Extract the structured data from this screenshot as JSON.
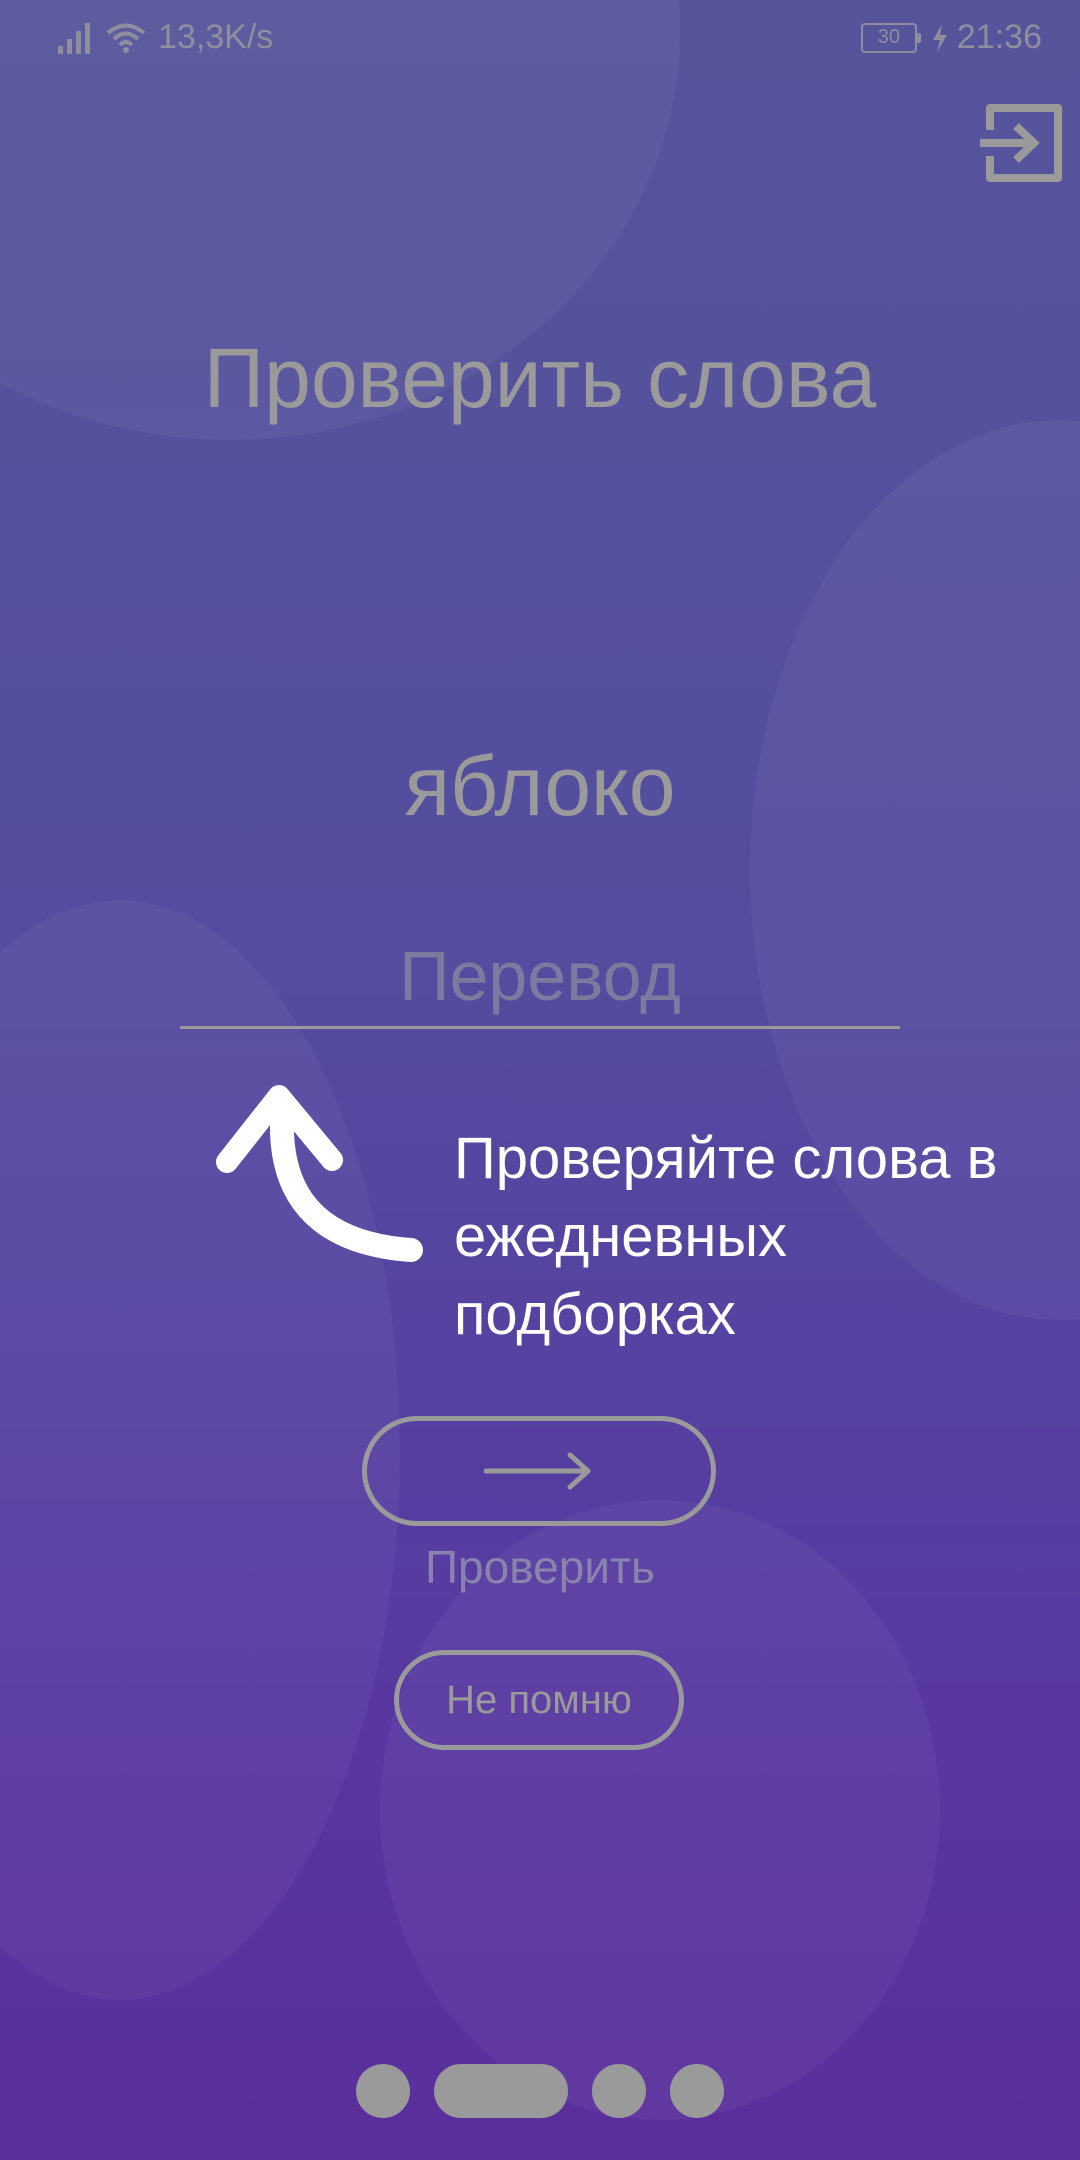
{
  "status_bar": {
    "network_speed": "13,3K/s",
    "battery_level": "30",
    "time": "21:36"
  },
  "header": {
    "logout_icon": "exit-arrow-icon"
  },
  "main": {
    "title": "Проверить слова",
    "word": "яблоко",
    "translation_placeholder": "Перевод",
    "translation_value": "",
    "hint_text": "Проверяйте слова в ежедневных подборках",
    "check_button_icon": "arrow-right-icon",
    "check_label": "Проверить",
    "dont_remember_label": "Не помню"
  },
  "pager": {
    "pages": 4,
    "active_page": 2
  },
  "colors": {
    "background_top": "#56559b",
    "background_bottom": "#5a2e9b",
    "muted": "#9a9a9a",
    "hint": "#ffffff"
  }
}
